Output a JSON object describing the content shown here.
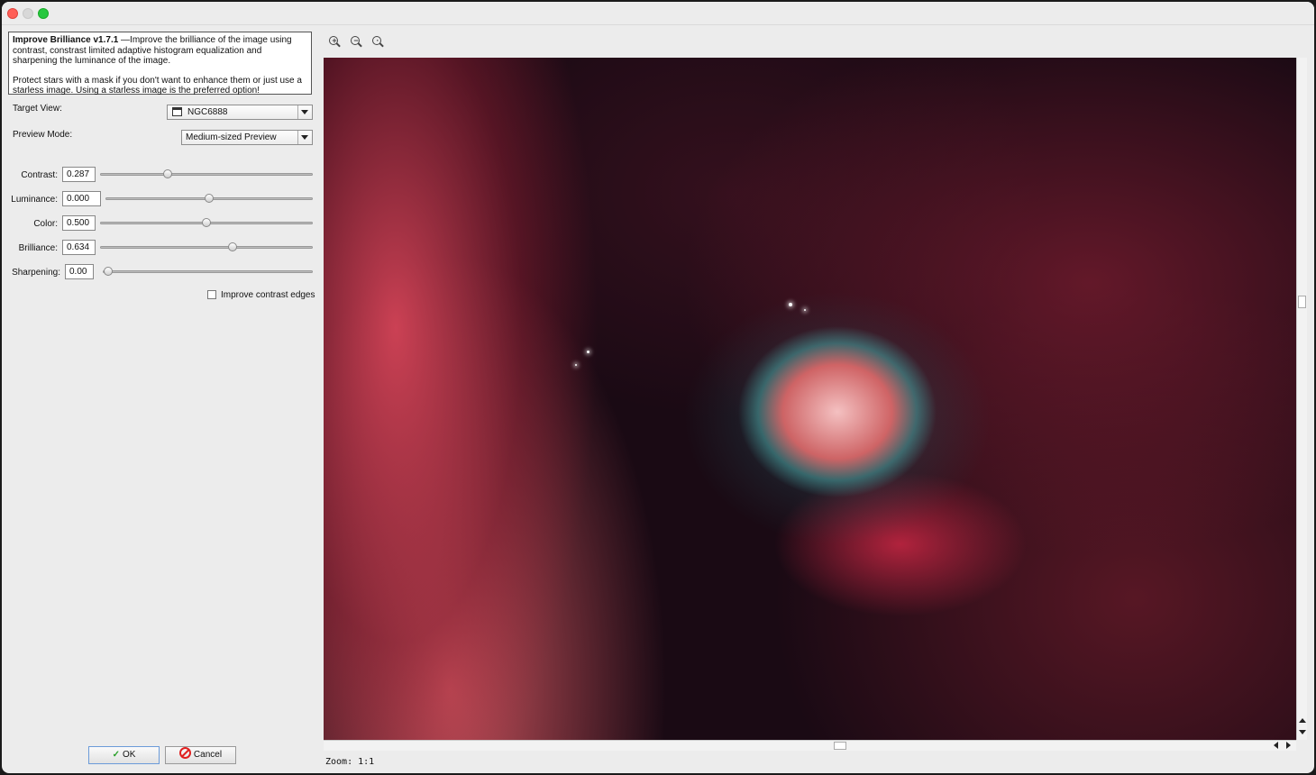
{
  "window": {
    "controls": [
      "close",
      "minimize",
      "zoom"
    ]
  },
  "description": {
    "title": "Improve Brilliance v1.7.1",
    "text1": " —Improve the brilliance of the image using contrast, constrast limited adaptive histogram equalization and sharpening the luminance of the image.",
    "text2": "Protect stars with a mask if you don't want to enhance them or just use a starless image. Using a starless image is the preferred option!"
  },
  "target_view": {
    "label": "Target View:",
    "value": "NGC6888",
    "icon": "window-icon"
  },
  "preview_mode": {
    "label": "Preview Mode:",
    "value": "Medium-sized Preview"
  },
  "sliders": [
    {
      "label": "Contrast:",
      "value": "0.287",
      "fraction": 0.31
    },
    {
      "label": "Luminance:",
      "value": "0.000",
      "fraction": 0.5
    },
    {
      "label": "Color:",
      "value": "0.500",
      "fraction": 0.5
    },
    {
      "label": "Brilliance:",
      "value": "0.634",
      "fraction": 0.63
    },
    {
      "label": "Sharpening:",
      "value": "0.00",
      "fraction": 0.0
    }
  ],
  "improve_edges": {
    "label": "Improve contrast edges",
    "checked": false
  },
  "buttons": {
    "ok": "OK",
    "cancel": "Cancel"
  },
  "zoom": {
    "label": "Zoom: 1:1",
    "tools": [
      "zoom-in-icon",
      "zoom-out-icon",
      "zoom-fit-icon"
    ]
  },
  "colors": {
    "ok_check": "#2aa02a",
    "cancel_icon": "#e02020",
    "close": "#ff5f57",
    "maximize": "#28c840"
  }
}
